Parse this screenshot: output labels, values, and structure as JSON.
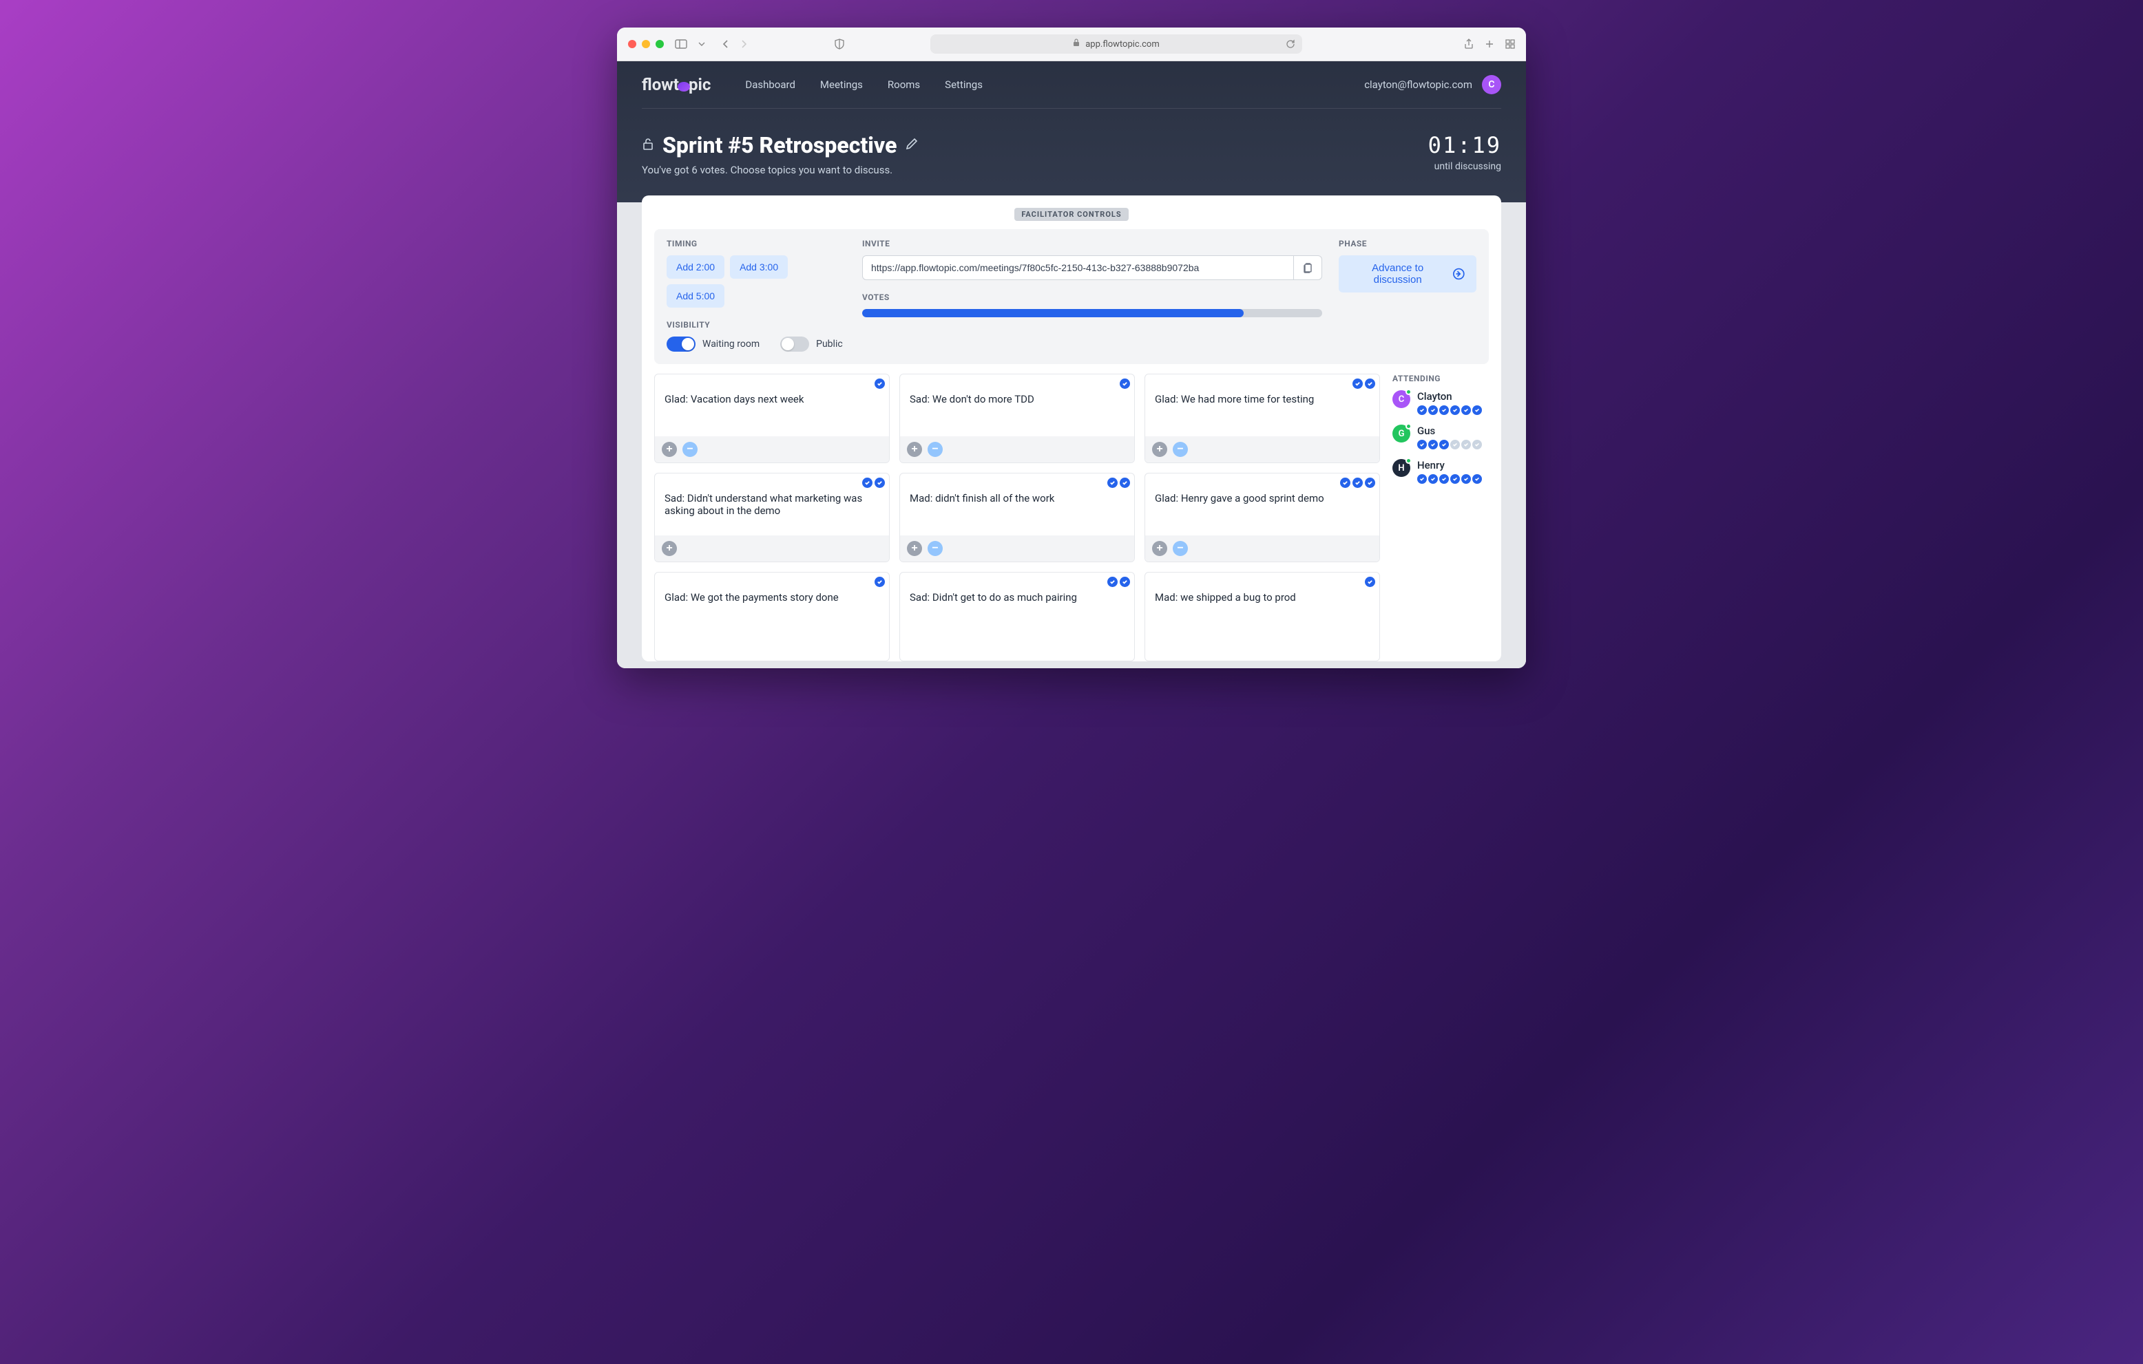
{
  "browser": {
    "url": "app.flowtopic.com"
  },
  "brand": "flowtopic",
  "nav": {
    "items": [
      "Dashboard",
      "Meetings",
      "Rooms",
      "Settings"
    ]
  },
  "user": {
    "email": "clayton@flowtopic.com",
    "initial": "C"
  },
  "meeting": {
    "title": "Sprint #5 Retrospective",
    "subtitle": "You've got 6 votes. Choose topics you want to discuss.",
    "timer": "01:19",
    "timer_label": "until discussing"
  },
  "controls": {
    "badge": "FACILITATOR CONTROLS",
    "timing": {
      "label": "TIMING",
      "buttons": [
        "Add 2:00",
        "Add 3:00",
        "Add 5:00"
      ]
    },
    "invite": {
      "label": "INVITE",
      "url": "https://app.flowtopic.com/meetings/7f80c5fc-2150-413c-b327-63888b9072ba"
    },
    "phase": {
      "label": "PHASE",
      "button": "Advance to discussion"
    },
    "visibility": {
      "label": "VISIBILITY",
      "waiting_room": {
        "label": "Waiting room",
        "on": true
      },
      "public": {
        "label": "Public",
        "on": false
      }
    },
    "votes": {
      "label": "VOTES",
      "percent": 83
    }
  },
  "cards": [
    {
      "text": "Glad: Vacation days next week",
      "votes": 1,
      "show_minus": true
    },
    {
      "text": "Sad: We don't do more TDD",
      "votes": 1,
      "show_minus": true
    },
    {
      "text": "Glad: We had more time for testing",
      "votes": 2,
      "show_minus": true
    },
    {
      "text": "Sad: Didn't understand what marketing was asking about in the demo",
      "votes": 2,
      "show_minus": false
    },
    {
      "text": "Mad: didn't finish all of the work",
      "votes": 2,
      "show_minus": true
    },
    {
      "text": "Glad: Henry gave a good sprint demo",
      "votes": 3,
      "show_minus": true
    },
    {
      "text": "Glad: We got the payments story done",
      "votes": 1,
      "show_minus": false,
      "no_footer": true
    },
    {
      "text": "Sad: Didn't get to do as much pairing",
      "votes": 2,
      "show_minus": false,
      "no_footer": true
    },
    {
      "text": "Mad: we shipped a bug to prod",
      "votes": 1,
      "show_minus": false,
      "no_footer": true
    }
  ],
  "attending": {
    "label": "ATTENDING",
    "people": [
      {
        "name": "Clayton",
        "initial": "C",
        "class": "c",
        "votes_used": 6,
        "votes_total": 6
      },
      {
        "name": "Gus",
        "initial": "G",
        "class": "g",
        "votes_used": 3,
        "votes_total": 6
      },
      {
        "name": "Henry",
        "initial": "H",
        "class": "h",
        "votes_used": 6,
        "votes_total": 6
      }
    ]
  }
}
